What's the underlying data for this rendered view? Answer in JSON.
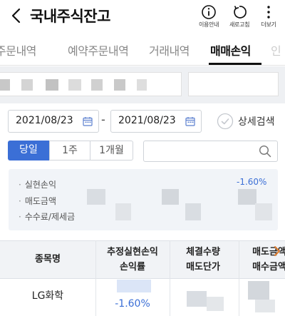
{
  "header": {
    "title": "국내주식잔고",
    "info_label": "이용안내",
    "refresh_label": "새로고침",
    "more_label": "더보기"
  },
  "tabs": [
    {
      "label": "주문내역"
    },
    {
      "label": "예약주문내역"
    },
    {
      "label": "거래내역"
    },
    {
      "label": "매매손익",
      "active": true
    },
    {
      "label": "인"
    }
  ],
  "date_range": {
    "start": "2021/08/23",
    "separator": "-",
    "end": "2021/08/23",
    "detail_search_label": "상세검색"
  },
  "period_buttons": [
    {
      "label": "당일",
      "selected": true
    },
    {
      "label": "1주"
    },
    {
      "label": "1개월"
    }
  ],
  "stock_search": {
    "placeholder": ""
  },
  "summary": {
    "realized_pl_label": "실현손익",
    "realized_pl_value": "-1.60%",
    "sell_amount_label": "매도금액",
    "fee_tax_label": "수수료/제세금"
  },
  "table": {
    "headers": [
      {
        "line1": "종목명",
        "line2": ""
      },
      {
        "line1": "추정실현손익",
        "line2": "손익률"
      },
      {
        "line1": "체결수량",
        "line2": "매도단가"
      },
      {
        "line1": "매도금액",
        "line2": "매수금액"
      }
    ],
    "rows": [
      {
        "name": "LG화학",
        "return_rate": "-1.60%"
      }
    ]
  },
  "colors": {
    "accent": "#3b6fd6",
    "negative": "#3b6fd6",
    "summary_bg": "#f1f4f8"
  }
}
